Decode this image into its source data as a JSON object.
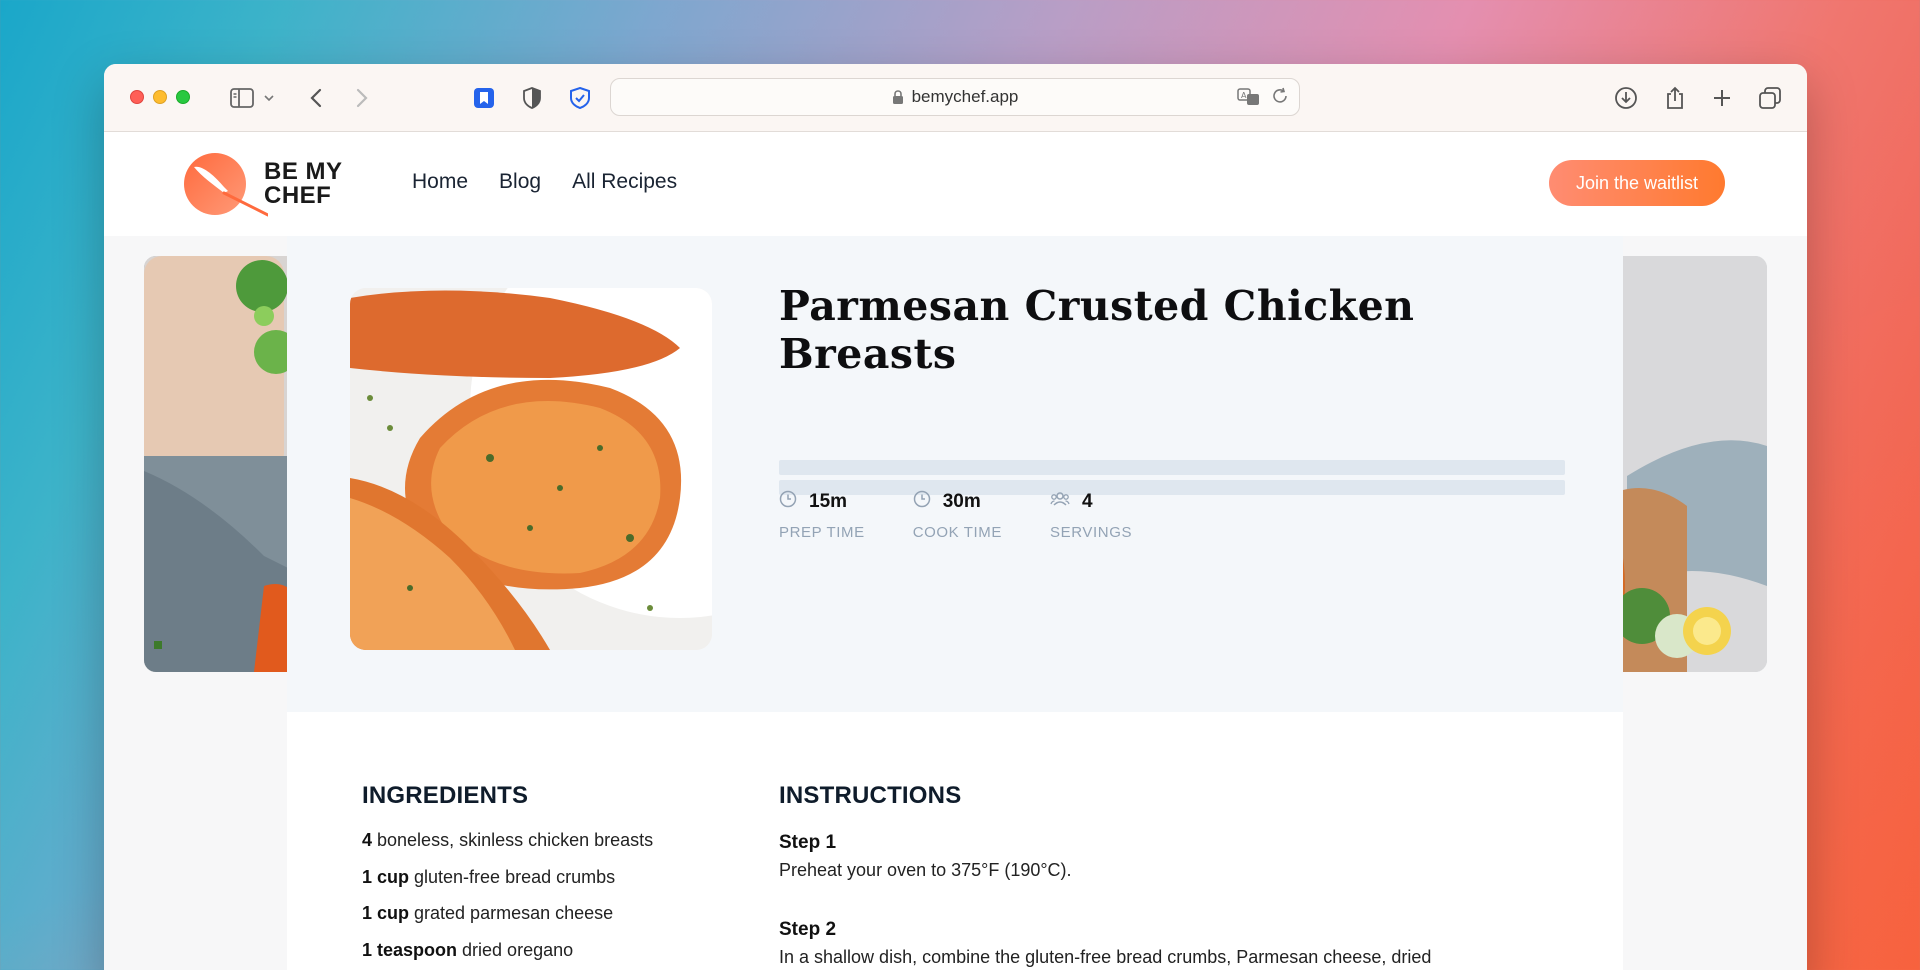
{
  "browser": {
    "url": "bemychef.app"
  },
  "site": {
    "logo_line1": "BE MY",
    "logo_line2": "CHEF",
    "nav": [
      "Home",
      "Blog",
      "All Recipes"
    ],
    "cta_label": "Join the waitlist"
  },
  "recipe": {
    "title": "Parmesan Crusted Chicken Breasts",
    "stats": [
      {
        "value": "15m",
        "label": "PREP TIME",
        "icon": "clock-icon"
      },
      {
        "value": "30m",
        "label": "COOK TIME",
        "icon": "clock-icon"
      },
      {
        "value": "4",
        "label": "SERVINGS",
        "icon": "people-icon"
      }
    ]
  },
  "ingredients": {
    "title": "INGREDIENTS",
    "items": [
      {
        "qty": "4",
        "text": " boneless, skinless chicken breasts"
      },
      {
        "qty": "1 cup",
        "text": " gluten-free bread crumbs"
      },
      {
        "qty": "1 cup",
        "text": " grated parmesan cheese"
      },
      {
        "qty": "1 teaspoon",
        "text": " dried oregano"
      }
    ]
  },
  "instructions": {
    "title": "INSTRUCTIONS",
    "steps": [
      {
        "title": "Step 1",
        "text": "Preheat your oven to 375°F (190°C)."
      },
      {
        "title": "Step 2",
        "text": "In a shallow dish, combine the gluten-free bread crumbs, Parmesan cheese, dried"
      }
    ]
  },
  "colors": {
    "accent": "#ff7a2f",
    "cta_gradient_start": "#ff8c72"
  }
}
